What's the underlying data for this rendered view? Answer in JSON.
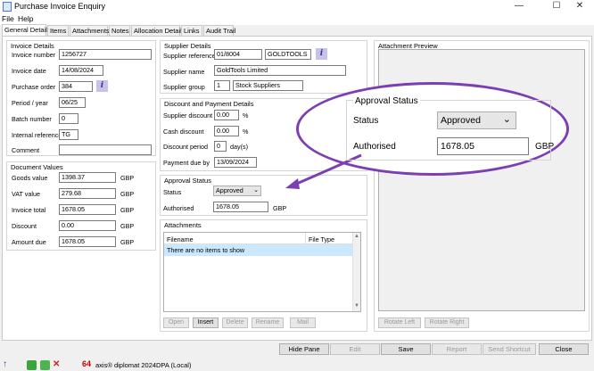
{
  "window": {
    "title": "Purchase Invoice Enquiry",
    "minimize": "—",
    "maximize": "☐",
    "close": "✕"
  },
  "menu": [
    "File",
    "Help"
  ],
  "tabs": [
    "General Details",
    "Items",
    "Attachments",
    "Notes",
    "Allocation Details",
    "Links",
    "Audit Trail"
  ],
  "invoice_details": {
    "title": "Invoice Details",
    "invoice_number_label": "Invoice number",
    "invoice_number": "1256727",
    "invoice_date_label": "Invoice date",
    "invoice_date": "14/08/2024",
    "purchase_order_label": "Purchase order",
    "purchase_order": "384",
    "period_year_label": "Period / year",
    "period_year": "06/25",
    "batch_number_label": "Batch number",
    "batch_number": "0",
    "internal_reference_label": "Internal reference",
    "internal_reference": "TG",
    "comment_label": "Comment",
    "comment": ""
  },
  "document_values": {
    "title": "Document Values",
    "currency": "GBP",
    "goods_value_label": "Goods value",
    "goods_value": "1398.37",
    "vat_value_label": "VAT value",
    "vat_value": "279.68",
    "invoice_total_label": "Invoice total",
    "invoice_total": "1678.05",
    "discount_label": "Discount",
    "discount": "0.00",
    "amount_due_label": "Amount due",
    "amount_due": "1678.05"
  },
  "supplier_details": {
    "title": "Supplier Details",
    "reference_label": "Supplier reference",
    "reference": "01/8004",
    "code": "GOLDTOOLS",
    "name_label": "Supplier name",
    "name": "GoldTools Limited",
    "group_label": "Supplier group",
    "group_code": "1",
    "group_name": "Stock Suppliers"
  },
  "discount_payment": {
    "title": "Discount and Payment Details",
    "supplier_discount_label": "Supplier discount",
    "supplier_discount": "0.00",
    "cash_discount_label": "Cash discount",
    "cash_discount": "0.00",
    "percent": "%",
    "discount_period_label": "Discount period",
    "discount_period": "0",
    "days": "day(s)",
    "payment_due_label": "Payment due by",
    "payment_due": "13/09/2024"
  },
  "approval": {
    "title": "Approval Status",
    "status_label": "Status",
    "status": "Approved",
    "authorised_label": "Authorised",
    "authorised": "1678.05",
    "currency": "GBP"
  },
  "attachments": {
    "title": "Attachments",
    "col_filename": "Filename",
    "col_filetype": "File Type",
    "empty_text": "There are no items to show",
    "buttons": {
      "open": "Open",
      "insert": "Insert",
      "delete": "Delete",
      "rename": "Rename",
      "mail": "Mail"
    }
  },
  "preview": {
    "title": "Attachment Preview",
    "rotate_left": "Rotate Left",
    "rotate_right": "Rotate Right"
  },
  "bottom_buttons": {
    "hide_pane": "Hide Pane",
    "edit": "Edit",
    "save": "Save",
    "report": "Report",
    "send_shortcut": "Send Shortcut",
    "close": "Close"
  },
  "statusbar": {
    "product": "axis® diplomat 2024",
    "database": "DPA (Local)"
  },
  "callout": {
    "title": "Approval Status",
    "status_label": "Status",
    "status": "Approved",
    "authorised_label": "Authorised",
    "authorised": "1678.05",
    "currency": "GBP"
  },
  "colors": {
    "accent_purple": "#7b3fb3",
    "selection_blue": "#cce8ff"
  }
}
